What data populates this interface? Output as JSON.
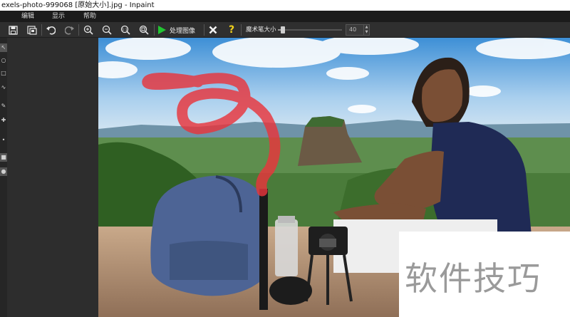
{
  "window": {
    "title": "exels-photo-999068 [原始大小].jpg - Inpaint"
  },
  "menu": {
    "items": [
      "编辑",
      "显示",
      "帮助"
    ]
  },
  "toolbar": {
    "process_label": "处理图像",
    "brush_size_label": "魔术笔大小",
    "brush_size_value": "40",
    "brush_size_fraction": 0.05,
    "icons": [
      "save-icon",
      "save-as-icon",
      "undo-icon",
      "redo-icon",
      "zoom-in-icon",
      "zoom-out-icon",
      "actual-size-icon",
      "fit-window-icon",
      "play-icon",
      "close-icon",
      "help-icon"
    ]
  },
  "tools": {
    "glyphs": [
      "↖",
      "○",
      "□",
      "∿",
      "✎",
      "✚",
      "•",
      "■",
      "●"
    ]
  },
  "watermark": {
    "text": "软件技巧"
  },
  "colors": {
    "stroke": "#e8343c",
    "process_green": "#22c532",
    "help_yellow": "#f2d21b"
  }
}
